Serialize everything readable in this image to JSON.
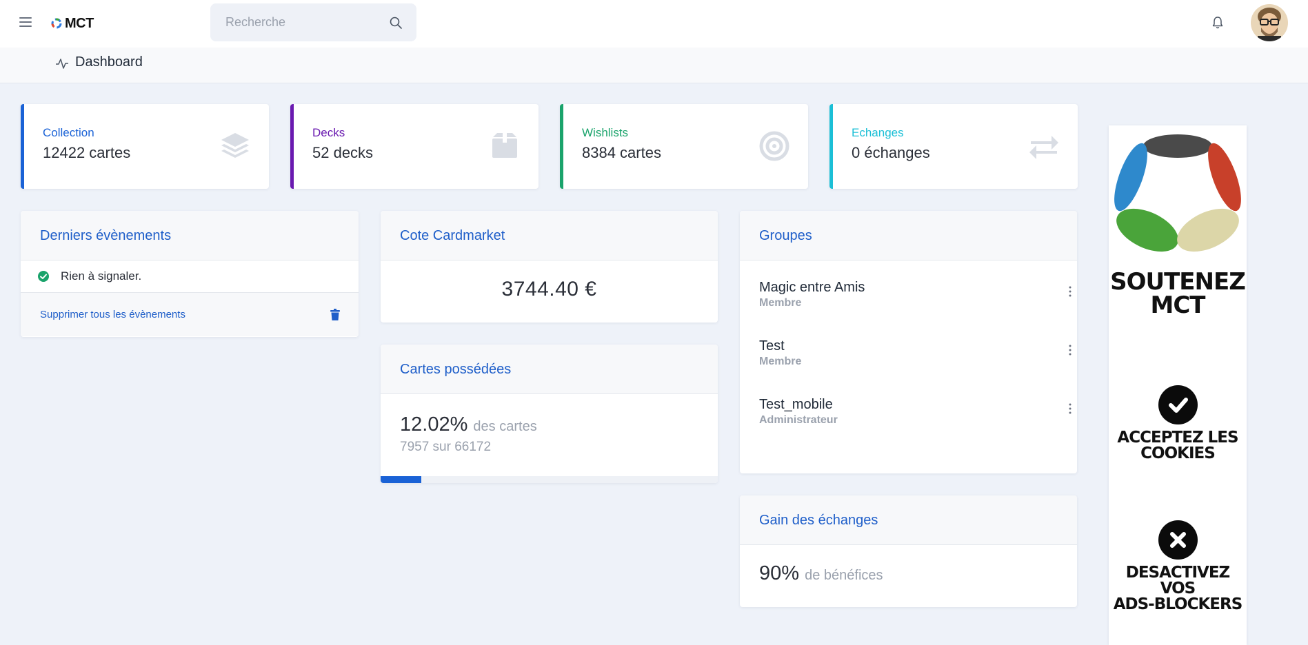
{
  "app": {
    "logo_text": "MCT"
  },
  "search": {
    "placeholder": "Recherche"
  },
  "breadcrumb": {
    "title": "Dashboard"
  },
  "stats": [
    {
      "label": "Collection",
      "value": "12422 cartes",
      "color": "#1a62d6",
      "icon": "layers-icon"
    },
    {
      "label": "Decks",
      "value": "52 decks",
      "color": "#6a1ab0",
      "icon": "box-icon"
    },
    {
      "label": "Wishlists",
      "value": "8384 cartes",
      "color": "#1aa36b",
      "icon": "target-icon"
    },
    {
      "label": "Echanges",
      "value": "0 échanges",
      "color": "#1bbfd6",
      "icon": "exchange-icon"
    }
  ],
  "events": {
    "title": "Derniers évènements",
    "item": "Rien à signaler.",
    "delete_label": "Supprimer tous les évènements"
  },
  "cote": {
    "title": "Cote Cardmarket",
    "value": "3744.40 €"
  },
  "owned": {
    "title": "Cartes possédées",
    "percent": "12.02%",
    "percent_suffix": "des cartes",
    "detail": "7957 sur 66172",
    "progress": 0.1202
  },
  "groups": {
    "title": "Groupes",
    "items": [
      {
        "name": "Magic entre Amis",
        "role": "Membre"
      },
      {
        "name": "Test",
        "role": "Membre"
      },
      {
        "name": "Test_mobile",
        "role": "Administrateur"
      }
    ]
  },
  "gain": {
    "title": "Gain des échanges",
    "percent": "90%",
    "suffix": "de bénéfices"
  },
  "ad": {
    "line1": "SOUTENEZ",
    "line2": "MCT",
    "cookies_1": "ACCEPTEZ LES",
    "cookies_2": "COOKIES",
    "block_1": "DESACTIVEZ",
    "block_2": "VOS",
    "block_3": "ADS-BLOCKERS"
  }
}
